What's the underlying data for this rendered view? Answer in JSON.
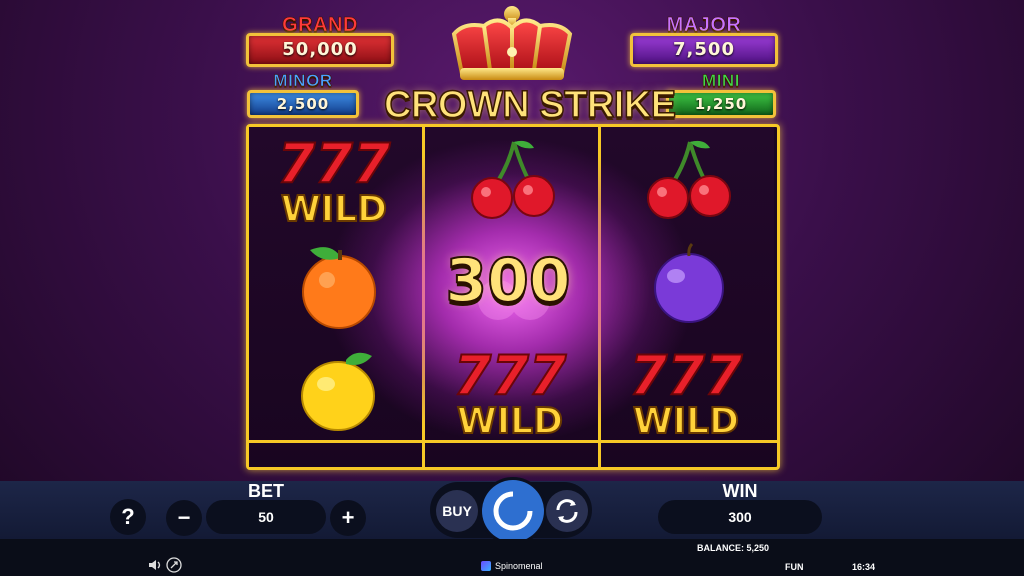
{
  "jackpots": {
    "grand": {
      "label": "GRAND",
      "value": "50,000",
      "label_color": "#ff3a3a"
    },
    "major": {
      "label": "MAJOR",
      "value": "7,500",
      "label_color": "#c873ff"
    },
    "minor": {
      "label": "MINOR",
      "value": "2,500",
      "label_color": "#4aa0ff"
    },
    "mini": {
      "label": "MINI",
      "value": "1,250",
      "label_color": "#3fd84a"
    }
  },
  "logo": "CROWN STRIKE",
  "reels": [
    [
      "wild-777",
      "orange",
      "lemon"
    ],
    [
      "cherry",
      "cherry-highlighted",
      "wild-777"
    ],
    [
      "cherry",
      "plum",
      "wild-777"
    ]
  ],
  "win_display": "300",
  "controls": {
    "help": "?",
    "bet_title": "BET",
    "bet_value": "50",
    "minus": "−",
    "plus": "+",
    "buy": "BUY",
    "win_title": "WIN",
    "win_value": "300",
    "balance": "BALANCE: 5,250"
  },
  "status_bar": {
    "brand": "Spinomenal",
    "mode": "FUN",
    "time": "16:34"
  },
  "colors": {
    "frame_gold": "#f7c926",
    "bar_bg": "#1d2648"
  }
}
